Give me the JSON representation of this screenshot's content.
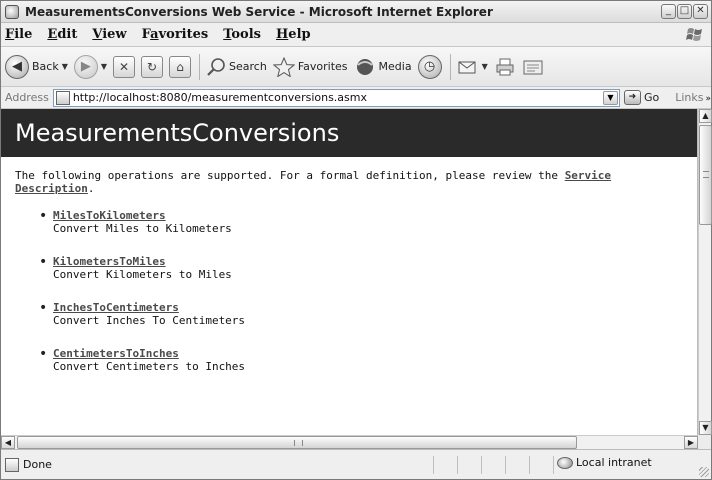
{
  "window": {
    "title": "MeasurementsConversions Web Service - Microsoft Internet Explorer",
    "minimize_glyph": "_",
    "maximize_glyph": "□",
    "close_glyph": "✕"
  },
  "menu": [
    {
      "hotkey": "F",
      "rest": "ile"
    },
    {
      "hotkey": "E",
      "rest": "dit"
    },
    {
      "hotkey": "V",
      "rest": "iew"
    },
    {
      "pre": "F",
      "hotkey": "a",
      "rest": "vorites"
    },
    {
      "hotkey": "T",
      "rest": "ools"
    },
    {
      "hotkey": "H",
      "rest": "elp"
    }
  ],
  "toolbar": {
    "back_label": "Back",
    "search_label": "Search",
    "favorites_label": "Favorites",
    "media_label": "Media"
  },
  "address": {
    "label": "Address",
    "url": "http://localhost:8080/measurementconversions.asmx",
    "go_label": "Go",
    "links_label": "Links",
    "links_more": "»"
  },
  "page": {
    "heading": "MeasurementsConversions",
    "intro_text": "The following operations are supported. For a formal definition, please review the ",
    "intro_link": "Service Description",
    "intro_end": ".",
    "operations": [
      {
        "name": "MilesToKilometers",
        "description": "Convert Miles to Kilometers"
      },
      {
        "name": "KilometersToMiles",
        "description": "Convert Kilometers to Miles"
      },
      {
        "name": "InchesToCentimeters",
        "description": "Convert Inches To Centimeters"
      },
      {
        "name": "CentimetersToInches",
        "description": "Convert Centimeters to Inches"
      }
    ]
  },
  "status": {
    "text": "Done",
    "zone": "Local intranet"
  },
  "icons": {
    "window_icon": "ie-page-icon",
    "back": "back-arrow-icon",
    "forward": "forward-arrow-icon",
    "stop": "stop-icon",
    "refresh": "refresh-icon",
    "home": "home-icon",
    "search": "search-icon",
    "favorites": "favorites-star-icon",
    "media": "media-icon",
    "history": "history-icon",
    "mail": "mail-icon",
    "print": "print-icon",
    "edit": "edit-icon"
  },
  "colors": {
    "heading_bar": "#2a2a2a",
    "heading_text": "#ffffff",
    "link": "#4a4a4a"
  }
}
